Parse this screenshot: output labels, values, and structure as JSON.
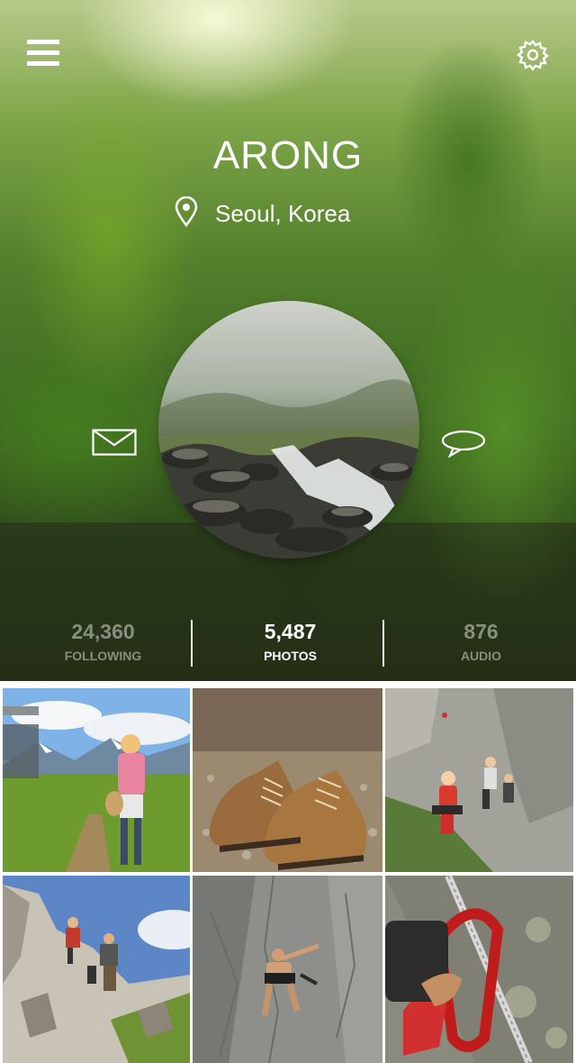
{
  "profile": {
    "name": "ARONG",
    "location": "Seoul, Korea"
  },
  "stats": [
    {
      "value": "24,360",
      "label": "FOLLOWING"
    },
    {
      "value": "5,487",
      "label": "PHOTOS"
    },
    {
      "value": "876",
      "label": "AUDIO"
    }
  ],
  "icons": {
    "menu": "menu-icon",
    "settings": "gear-icon",
    "location": "location-pin-icon",
    "message": "mail-icon",
    "chat": "chat-bubble-icon"
  },
  "colors": {
    "text_primary": "#ffffff",
    "text_dim": "#9aa08a"
  }
}
